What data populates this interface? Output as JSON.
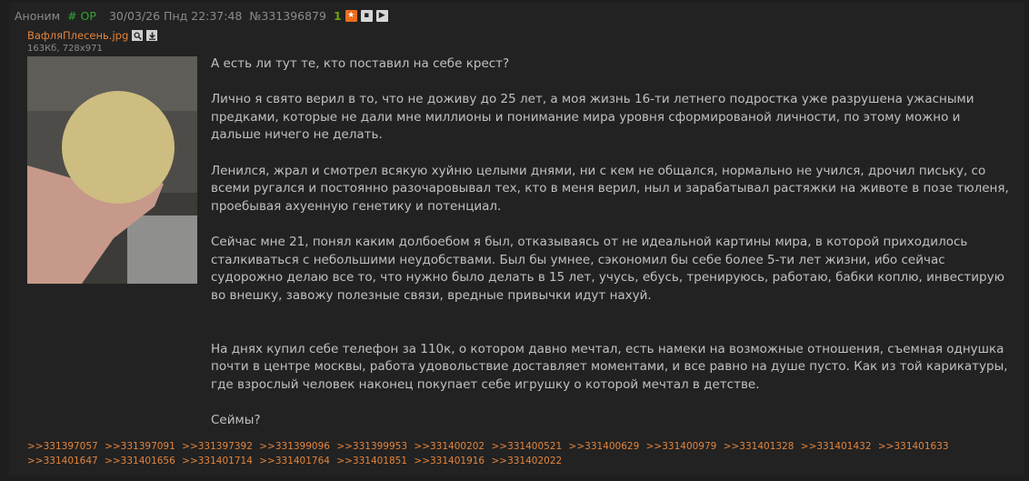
{
  "post": {
    "author": "Аноним",
    "op_tag": "# OP",
    "date": "30/03/26 Пнд 22:37:48",
    "number": "№331396879",
    "count": "1",
    "file_name": "ВафляПлесень.jpg",
    "file_info": "163Кб, 728x971",
    "paragraphs": [
      "А есть ли тут те, кто поставил на себе крест?",
      "Лично я свято верил в то, что не доживу до 25 лет, а моя жизнь 16-ти летнего подростка уже разрушена ужасными предками, которые не дали мне миллионы и понимание мира уровня сформированой личности, по этому можно и дальше ничего не делать.",
      "Ленился, жрал и смотрел всякую хуйню целыми днями, ни с кем не общался, нормально не учился, дрочил письку, со всеми ругался и постоянно разочаровывал тех, кто в меня верил, ныл и зарабатывал растяжки на животе в позе тюленя, проебывая ахуенную генетику и потенциал.",
      "Сейчас мне 21, понял каким долбоебом я был, отказываясь от не идеальной картины мира, в которой приходилось сталкиваться с небольшими неудобствами. Был бы умнее, сэкономил бы себе более 5-ти лет жизни, ибо сейчас судорожно делаю все то, что нужно было делать в 15 лет, учусь, ебусь, тренируюсь, работаю, бабки коплю, инвестирую во внешку, завожу полезные связи, вредные привычки идут нахуй.",
      "На днях купил себе телефон за 110к, о котором давно мечтал, есть намеки на возможные отношения, съемная однушка почти в центре москвы, работа удовольствие доставляет моментами, и все равно на душе пусто. Как из той карикатуры, где взрослый человек наконец покупает себе игрушку о которой мечтал в детстве.",
      "Сеймы?"
    ],
    "replies": [
      ">>331397057",
      ">>331397091",
      ">>331397392",
      ">>331399096",
      ">>331399953",
      ">>331400202",
      ">>331400521",
      ">>331400629",
      ">>331400979",
      ">>331401328",
      ">>331401432",
      ">>331401633",
      ">>331401647",
      ">>331401656",
      ">>331401714",
      ">>331401764",
      ">>331401851",
      ">>331401916",
      ">>331402022"
    ]
  },
  "icons": {
    "favorite": "star-icon",
    "hide": "hide-icon",
    "play": "play-icon",
    "search": "search-icon",
    "download": "download-icon"
  },
  "colors": {
    "background": "#1e1e1e",
    "post_background": "#222222",
    "link": "#e3843c",
    "op": "#33a833",
    "text": "#c0c0c0"
  }
}
